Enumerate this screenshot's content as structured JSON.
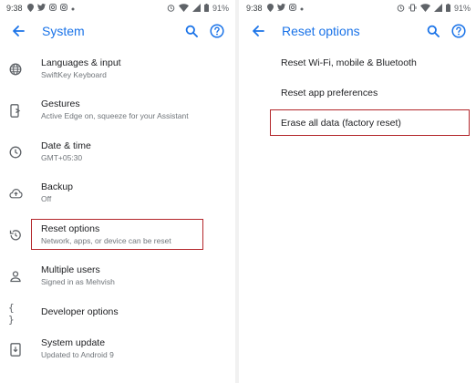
{
  "left": {
    "status": {
      "time": "9:38",
      "battery": "91%"
    },
    "toolbar": {
      "title": "System"
    },
    "items": [
      {
        "title": "Languages & input",
        "subtitle": "SwiftKey Keyboard"
      },
      {
        "title": "Gestures",
        "subtitle": "Active Edge on, squeeze for your Assistant"
      },
      {
        "title": "Date & time",
        "subtitle": "GMT+05:30"
      },
      {
        "title": "Backup",
        "subtitle": "Off"
      },
      {
        "title": "Reset options",
        "subtitle": "Network, apps, or device can be reset"
      },
      {
        "title": "Multiple users",
        "subtitle": "Signed in as Mehvish"
      },
      {
        "title": "Developer options",
        "subtitle": ""
      },
      {
        "title": "System update",
        "subtitle": "Updated to Android 9"
      }
    ]
  },
  "right": {
    "status": {
      "time": "9:38",
      "battery": "91%"
    },
    "toolbar": {
      "title": "Reset options"
    },
    "items": [
      {
        "title": "Reset Wi-Fi, mobile & Bluetooth"
      },
      {
        "title": "Reset app preferences"
      },
      {
        "title": "Erase all data (factory reset)"
      }
    ]
  },
  "colors": {
    "accent": "#1a73e8",
    "highlight": "#b3262b"
  },
  "icons": [
    "location-icon",
    "twitter-icon",
    "instagram-icon",
    "alarm-icon",
    "wifi-icon",
    "signal-icon",
    "battery-icon",
    "back-arrow-icon",
    "search-icon",
    "help-icon",
    "globe-icon",
    "gestures-icon",
    "clock-icon",
    "backup-icon",
    "reset-icon",
    "person-icon",
    "braces-icon",
    "system-update-icon"
  ]
}
